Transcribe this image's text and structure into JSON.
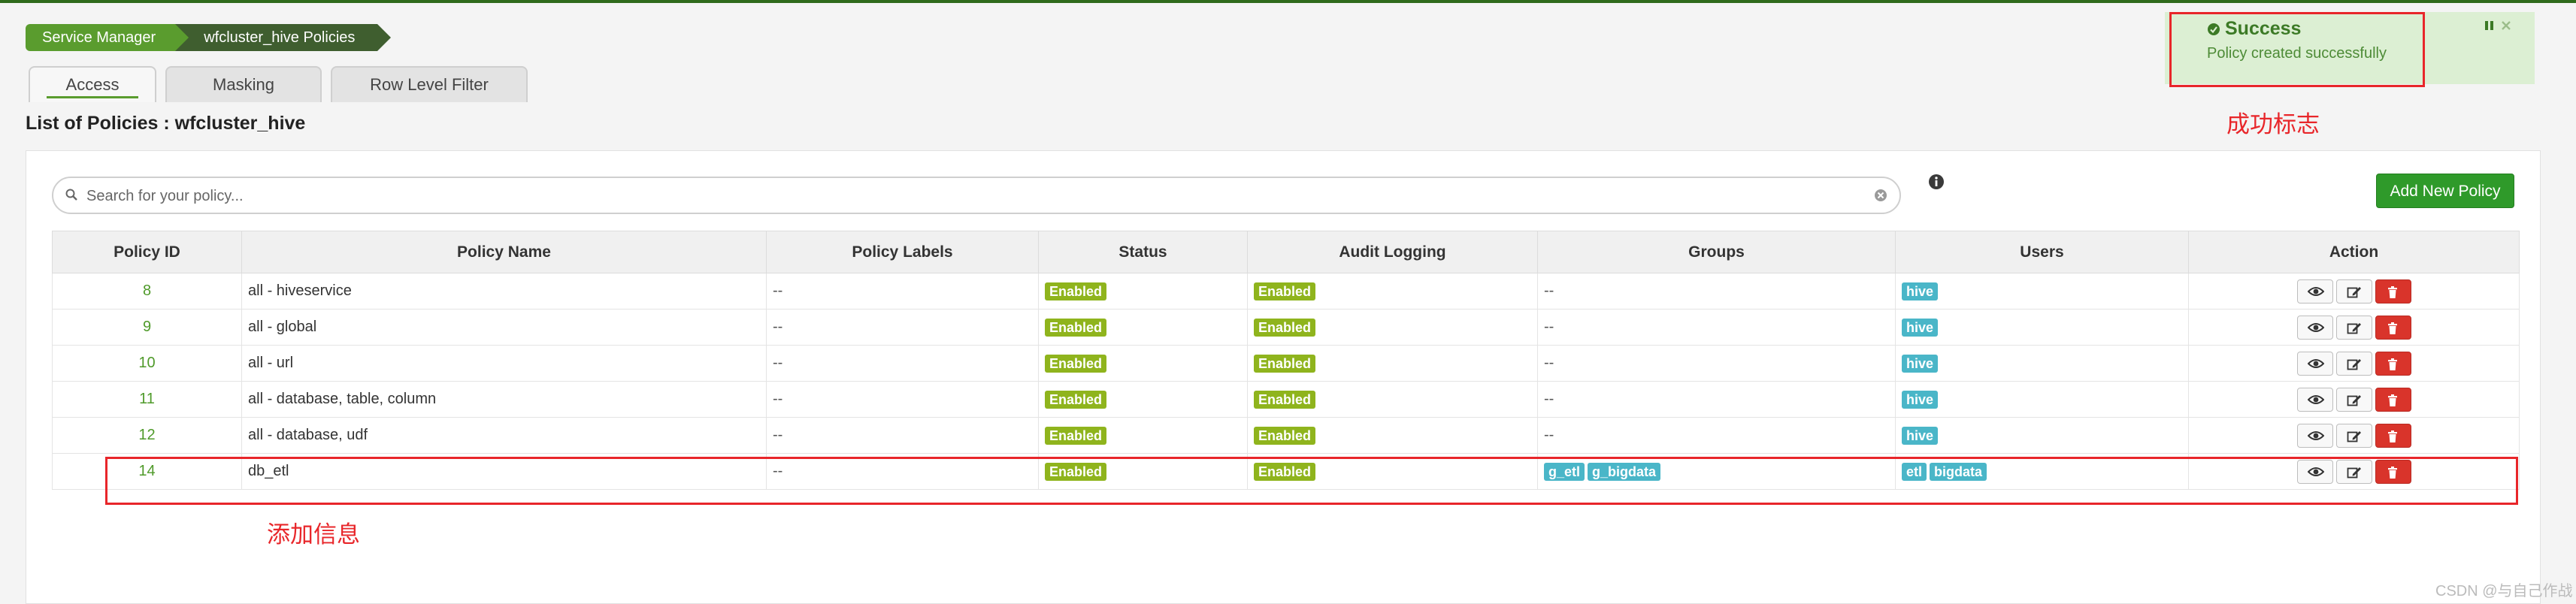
{
  "breadcrumb": [
    "Service Manager",
    "wfcluster_hive Policies"
  ],
  "tabs": [
    {
      "label": "Access",
      "active": true
    },
    {
      "label": "Masking",
      "active": false
    },
    {
      "label": "Row Level Filter",
      "active": false
    }
  ],
  "page_title": "List of Policies : wfcluster_hive",
  "search": {
    "placeholder": "Search for your policy...",
    "value": ""
  },
  "add_button": "Add New Policy",
  "table": {
    "headers": [
      "Policy ID",
      "Policy Name",
      "Policy Labels",
      "Status",
      "Audit Logging",
      "Groups",
      "Users",
      "Action"
    ],
    "rows": [
      {
        "id": "8",
        "name": "all - hiveservice",
        "labels": "--",
        "status": "Enabled",
        "audit": "Enabled",
        "groups": "--",
        "users": [
          "hive"
        ]
      },
      {
        "id": "9",
        "name": "all - global",
        "labels": "--",
        "status": "Enabled",
        "audit": "Enabled",
        "groups": "--",
        "users": [
          "hive"
        ]
      },
      {
        "id": "10",
        "name": "all - url",
        "labels": "--",
        "status": "Enabled",
        "audit": "Enabled",
        "groups": "--",
        "users": [
          "hive"
        ]
      },
      {
        "id": "11",
        "name": "all - database, table, column",
        "labels": "--",
        "status": "Enabled",
        "audit": "Enabled",
        "groups": "--",
        "users": [
          "hive"
        ]
      },
      {
        "id": "12",
        "name": "all - database, udf",
        "labels": "--",
        "status": "Enabled",
        "audit": "Enabled",
        "groups": "--",
        "users": [
          "hive"
        ]
      },
      {
        "id": "14",
        "name": "db_etl",
        "labels": "--",
        "status": "Enabled",
        "audit": "Enabled",
        "groups": [
          "g_etl",
          "g_bigdata"
        ],
        "users": [
          "etl",
          "bigdata"
        ]
      }
    ]
  },
  "toast": {
    "title": "Success",
    "message": "Policy created successfully"
  },
  "annotations": {
    "toast_label": "成功标志",
    "row_label": "添加信息"
  },
  "watermark": "CSDN @与自己作战",
  "colors": {
    "brand_green": "#5a9c2e",
    "dark_green": "#3f5e2f",
    "badge_enabled": "#8fb41d",
    "badge_user": "#4ab6c8",
    "delete_red": "#d9342b",
    "annotation_red": "#e8262a"
  },
  "icons": {
    "search": "search-icon",
    "clear": "clear-icon",
    "info": "info-icon",
    "view": "eye-icon",
    "edit": "edit-icon",
    "delete": "trash-icon",
    "success": "check-circle-icon",
    "pause": "pause-icon",
    "close": "close-icon"
  }
}
